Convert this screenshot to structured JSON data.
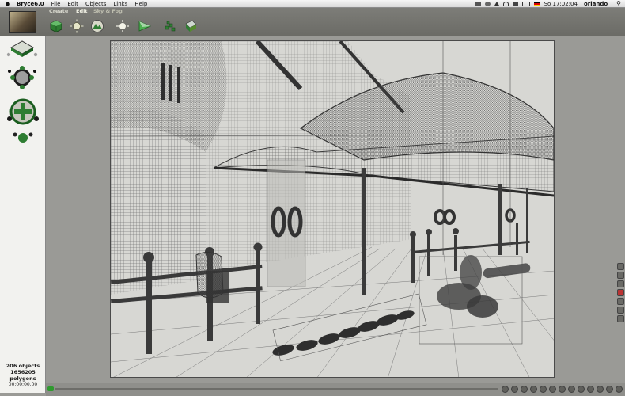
{
  "menubar": {
    "apple": "",
    "app_name": "Bryce6.0",
    "menus": [
      "File",
      "Edit",
      "Objects",
      "Links",
      "Help"
    ],
    "clock": "So 17:02:04",
    "user": "orlando"
  },
  "toolbar": {
    "tabs": [
      "Create",
      "Edit",
      "Sky & Fog"
    ],
    "tools": [
      "cube-edit-icon",
      "light-edit-icon",
      "terrain-edit-icon",
      "material-edit-icon",
      "repeat-icon",
      "randomize-icon",
      "texture-icon"
    ]
  },
  "stats": {
    "objects": "206 objects",
    "polygons": "1656205 polygons",
    "time": "00:00:00.00"
  },
  "viewport": {
    "mode": "wireframe",
    "colors": {
      "background": "#d7d7d3",
      "wire": "#3a3a3a",
      "solid": "#3b3b3b"
    }
  }
}
